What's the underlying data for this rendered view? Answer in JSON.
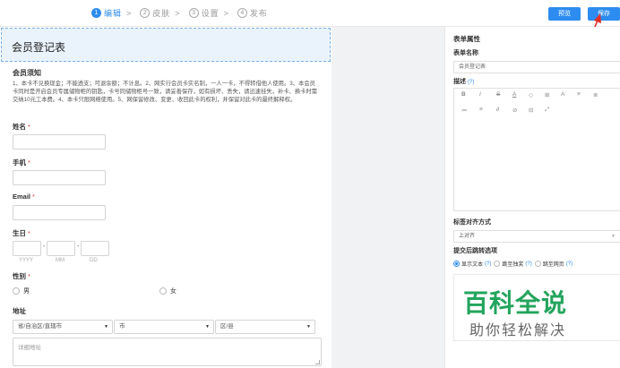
{
  "steps": [
    {
      "num": "1",
      "label": "编辑"
    },
    {
      "num": "2",
      "label": "皮肤"
    },
    {
      "num": "3",
      "label": "设置"
    },
    {
      "num": "4",
      "label": "发布"
    }
  ],
  "step_separator": ">",
  "toolbar": {
    "preview_label": "预览",
    "save_label": "保存"
  },
  "form": {
    "title": "会员登记表",
    "notice_title": "会员须知",
    "notice_text": "1、本卡不兑换现金；不能透支；可退余额；不计息。2、网实行会员卡实名制，一人一卡，不得转借他人使用。3、本会员卡同时是开启会员专属储物柜的钥匙，卡号同储物柜号一致，请妥善保存，如有损坏、丢失，请迅速挂失，补卡、换卡时需交纳10元工本费。4、本卡只限网络使用。5、网保留修改、变更、收回此卡的权利，并保留对此卡的最终解释权。",
    "required_mark": "*",
    "fields": {
      "name": "姓名",
      "phone": "手机",
      "email": "Email",
      "birthday": "生日",
      "gender": "性别",
      "address": "地址"
    },
    "birthday_sub": {
      "year": "YYYY",
      "month": "MM",
      "day": "DD",
      "dash": "-"
    },
    "gender_options": [
      "男",
      "女"
    ],
    "address": {
      "province": "省/自治区/直辖市",
      "city": "市",
      "district": "区/县",
      "detail_placeholder": "详细地址"
    }
  },
  "panel": {
    "heading": "表单属性",
    "form_name_label": "表单名称",
    "form_name_value": "会员登记表",
    "desc_label": "描述",
    "help_mark": "(?)",
    "align_label": "标签对齐方式",
    "align_value": "上对齐",
    "redirect_label": "提交后跳转选项",
    "redirect_options": [
      "显示文本",
      "跳至独奖",
      "跳至网页"
    ],
    "editor_toolbar_row1": [
      "B",
      "I",
      "S",
      "A",
      "◇",
      "⊞",
      "A˙",
      "≡",
      "≣"
    ],
    "editor_toolbar_row2": [
      "≔",
      "≡",
      "∂",
      "⊘",
      "⊟",
      "⤢"
    ]
  },
  "watermark": {
    "line1": "百科全说",
    "line2": "助你轻松解决"
  },
  "colors": {
    "accent": "#2d8cf0",
    "required": "#e5413b",
    "arrow": "#e0302a",
    "watermark": "#23a45d"
  }
}
